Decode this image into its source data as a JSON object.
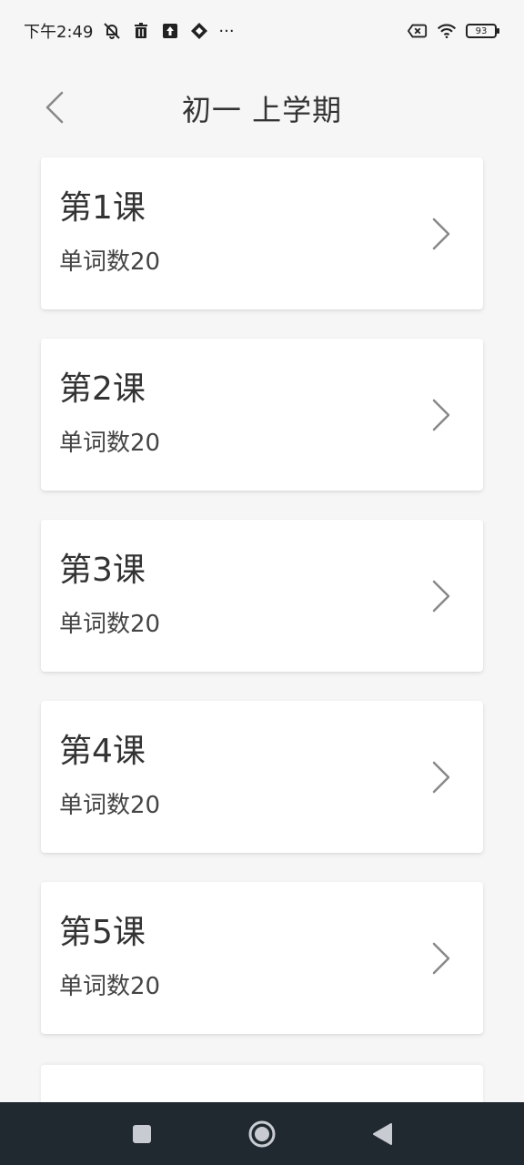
{
  "status_bar": {
    "time": "下午2:49",
    "more": "···",
    "battery": "93"
  },
  "header": {
    "title": "初一 上学期"
  },
  "lessons": [
    {
      "title": "第1课",
      "subtitle": "单词数20"
    },
    {
      "title": "第2课",
      "subtitle": "单词数20"
    },
    {
      "title": "第3课",
      "subtitle": "单词数20"
    },
    {
      "title": "第4课",
      "subtitle": "单词数20"
    },
    {
      "title": "第5课",
      "subtitle": "单词数20"
    }
  ],
  "icons": {
    "back": "chevron-left-icon",
    "item_arrow": "chevron-right-icon",
    "nav_recent": "square-icon",
    "nav_home": "circle-icon",
    "nav_back": "triangle-left-icon"
  },
  "colors": {
    "background": "#f6f6f6",
    "card": "#ffffff",
    "nav_bar": "#202830"
  }
}
